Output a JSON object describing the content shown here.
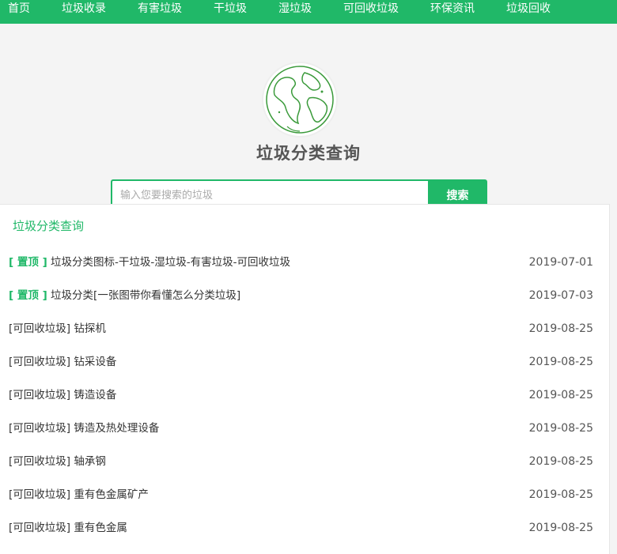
{
  "nav": {
    "items": [
      {
        "label": "首页"
      },
      {
        "label": "垃圾收录"
      },
      {
        "label": "有害垃圾"
      },
      {
        "label": "干垃圾"
      },
      {
        "label": "湿垃圾"
      },
      {
        "label": "可回收垃圾"
      },
      {
        "label": "环保资讯"
      },
      {
        "label": "垃圾回收"
      }
    ]
  },
  "hero": {
    "logo_icon": "globe-icon",
    "title": "垃圾分类查询"
  },
  "search": {
    "placeholder": "输入您要搜索的垃圾",
    "value": "",
    "button_label": "搜索"
  },
  "panel": {
    "title": "垃圾分类查询",
    "items": [
      {
        "pin": "[ 置顶 ]",
        "title": "垃圾分类图标-干垃圾-湿垃圾-有害垃圾-可回收垃圾",
        "date": "2019-07-01"
      },
      {
        "pin": "[ 置顶 ]",
        "title": "垃圾分类[一张图带你看懂怎么分类垃圾]",
        "date": "2019-07-03"
      },
      {
        "pin": "",
        "title": "[可回收垃圾] 钻探机",
        "date": "2019-08-25"
      },
      {
        "pin": "",
        "title": "[可回收垃圾] 钻采设备",
        "date": "2019-08-25"
      },
      {
        "pin": "",
        "title": "[可回收垃圾] 铸造设备",
        "date": "2019-08-25"
      },
      {
        "pin": "",
        "title": "[可回收垃圾] 铸造及热处理设备",
        "date": "2019-08-25"
      },
      {
        "pin": "",
        "title": "[可回收垃圾] 轴承钢",
        "date": "2019-08-25"
      },
      {
        "pin": "",
        "title": "[可回收垃圾] 重有色金属矿产",
        "date": "2019-08-25"
      },
      {
        "pin": "",
        "title": "[可回收垃圾] 重有色金属",
        "date": "2019-08-25"
      }
    ]
  },
  "colors": {
    "accent": "#20b868"
  }
}
